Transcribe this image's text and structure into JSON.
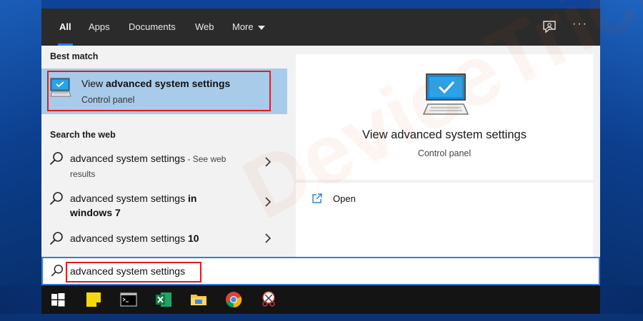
{
  "tabs": [
    {
      "label": "All",
      "active": true
    },
    {
      "label": "Apps"
    },
    {
      "label": "Documents"
    },
    {
      "label": "Web"
    },
    {
      "label": "More"
    }
  ],
  "header_icons": [
    "feedback-icon",
    "more-options-icon"
  ],
  "best_match": {
    "section_title": "Best match",
    "title_prefix": "View ",
    "title_bold": "advanced system settings",
    "subtitle": "Control panel",
    "icon": "monitor-checkmark-icon"
  },
  "web": {
    "section_title": "Search the web",
    "items": [
      {
        "text": "advanced system settings",
        "suffix": " - See web",
        "line2": "results"
      },
      {
        "text": "advanced system settings",
        "bold": " in",
        "line2_bold": "windows 7"
      },
      {
        "text": "advanced system settings",
        "bold": " 10"
      }
    ]
  },
  "preview": {
    "title": "View advanced system settings",
    "subtitle": "Control panel",
    "icon": "monitor-checkmark-icon",
    "actions": [
      {
        "label": "Open",
        "icon": "open-icon"
      }
    ]
  },
  "search": {
    "value": "advanced system settings",
    "icon": "search-icon"
  },
  "taskbar": [
    "windows-start-icon",
    "sticky-notes-icon",
    "command-prompt-icon",
    "excel-icon",
    "file-explorer-icon",
    "chrome-icon",
    "snipping-tool-icon"
  ],
  "colors": {
    "highlight": "#a9cbea",
    "accent": "#2f7de1",
    "annotation_red": "#e21d1d",
    "taskbar": "#141414",
    "tabbar": "#2b2b2b"
  }
}
